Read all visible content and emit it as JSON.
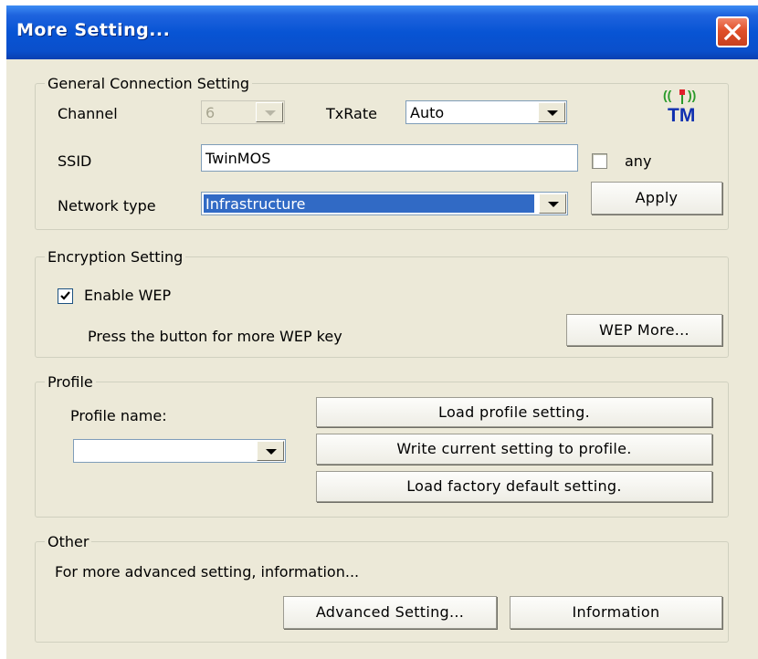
{
  "window": {
    "title": "More Setting..."
  },
  "general": {
    "legend": "General Connection Setting",
    "channel_label": "Channel",
    "channel_value": "6",
    "txrate_label": "TxRate",
    "txrate_value": "Auto",
    "ssid_label": "SSID",
    "ssid_value": "TwinMOS",
    "any_label": "any",
    "any_checked": false,
    "network_type_label": "Network type",
    "network_type_value": "Infrastructure",
    "apply_label": "Apply",
    "logo_text": "TM"
  },
  "encryption": {
    "legend": "Encryption Setting",
    "enable_wep_label": "Enable WEP",
    "enable_wep_checked": true,
    "hint": "Press the button for more WEP key",
    "wep_more_label": "WEP More..."
  },
  "profile": {
    "legend": "Profile",
    "name_label": "Profile name:",
    "name_value": "",
    "load_label": "Load profile setting.",
    "write_label": "Write current setting to profile.",
    "factory_label": "Load factory default setting."
  },
  "other": {
    "legend": "Other",
    "hint": "For more advanced setting, information...",
    "advanced_label": "Advanced Setting...",
    "information_label": "Information"
  },
  "colors": {
    "titlebar": "#0854d4",
    "selection": "#316ac5",
    "dialog_bg": "#ece9d8",
    "close": "#e0502a"
  }
}
